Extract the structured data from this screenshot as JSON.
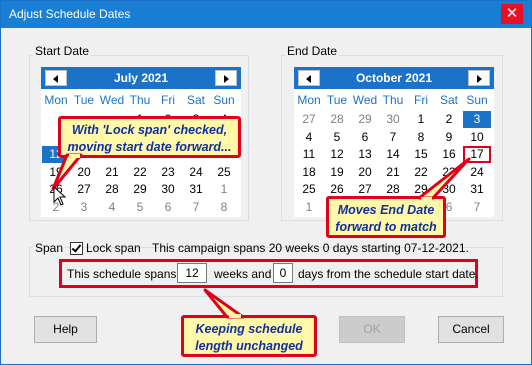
{
  "window": {
    "title": "Adjust Schedule Dates",
    "close_glyph": "✕",
    "accent_color": "#1a73c9",
    "highlight_color": "#e0001a"
  },
  "start_date": {
    "label": "Start Date",
    "month_label": "July 2021",
    "dow": [
      "Mon",
      "Tue",
      "Wed",
      "Thu",
      "Fri",
      "Sat",
      "Sun"
    ],
    "weeks": [
      [
        "",
        "",
        "",
        "1",
        "2",
        "3",
        "4"
      ],
      [
        "",
        "",
        "",
        "",
        "",
        "",
        ""
      ],
      [
        "12",
        "",
        "",
        "",
        "",
        "",
        ""
      ],
      [
        "19",
        "20",
        "21",
        "22",
        "23",
        "24",
        "25"
      ],
      [
        "26",
        "27",
        "28",
        "29",
        "30",
        "31",
        "1"
      ],
      [
        "2",
        "3",
        "4",
        "5",
        "6",
        "7",
        "8"
      ]
    ],
    "selected": "12"
  },
  "end_date": {
    "label": "End Date",
    "month_label": "October 2021",
    "dow": [
      "Mon",
      "Tue",
      "Wed",
      "Thu",
      "Fri",
      "Sat",
      "Sun"
    ],
    "weeks": [
      [
        "27",
        "28",
        "29",
        "30",
        "1",
        "2",
        "3"
      ],
      [
        "4",
        "5",
        "6",
        "7",
        "8",
        "9",
        "10"
      ],
      [
        "11",
        "12",
        "13",
        "14",
        "15",
        "16",
        "17"
      ],
      [
        "18",
        "19",
        "20",
        "21",
        "22",
        "23",
        "24"
      ],
      [
        "25",
        "26",
        "27",
        "28",
        "29",
        "30",
        "31"
      ],
      [
        "1",
        "2",
        "3",
        "4",
        "5",
        "6",
        "7"
      ]
    ],
    "selected": "3",
    "boxed": "17"
  },
  "span": {
    "group_label": "Span",
    "lock_label": "Lock span",
    "lock_checked": true,
    "campaign_text": "This campaign spans 20 weeks 0 days starting 07-12-2021.",
    "prefix": "This schedule spans",
    "weeks_value": "12",
    "weeks_label": "weeks and",
    "days_value": "0",
    "suffix": "days from the schedule start date."
  },
  "buttons": {
    "help": "Help",
    "ok": "OK",
    "cancel": "Cancel"
  },
  "callouts": {
    "lock_span": [
      "With 'Lock span' checked,",
      "moving start date forward..."
    ],
    "end_date": [
      "Moves End Date",
      "forward to match"
    ],
    "length": [
      "Keeping schedule",
      "length unchanged"
    ]
  }
}
